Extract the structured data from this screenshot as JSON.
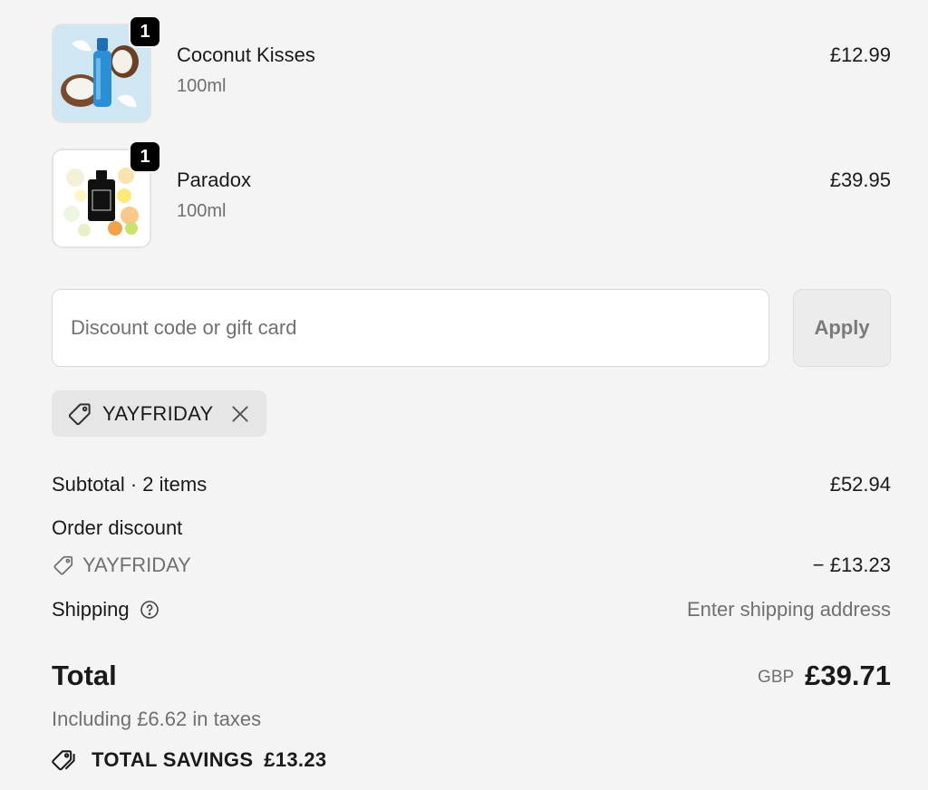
{
  "line_items": [
    {
      "name": "Coconut Kisses",
      "variant": "100ml",
      "price": "£12.99",
      "quantity": "1",
      "image_icon": "coconut-bottle-image"
    },
    {
      "name": "Paradox",
      "variant": "100ml",
      "price": "£39.95",
      "quantity": "1",
      "image_icon": "perfume-bottle-image"
    }
  ],
  "discount": {
    "placeholder": "Discount code or gift card",
    "value": "",
    "apply_label": "Apply",
    "applied_code": "YAYFRIDAY",
    "remove_icon": "close-icon"
  },
  "summary": {
    "subtotal_label": "Subtotal · 2 items",
    "subtotal_value": "£52.94",
    "order_discount_label": "Order discount",
    "discount_code": "YAYFRIDAY",
    "discount_value": "− £13.23",
    "shipping_label": "Shipping",
    "shipping_value": "Enter shipping address",
    "total_label": "Total",
    "currency": "GBP",
    "total_value": "£39.71",
    "taxes_note": "Including £6.62 in taxes",
    "savings_label": "TOTAL SAVINGS",
    "savings_value": "£13.23"
  },
  "colors": {
    "background": "#f4f4f4",
    "text": "#1a1a1a",
    "muted": "#707070",
    "badge": "#000000"
  }
}
